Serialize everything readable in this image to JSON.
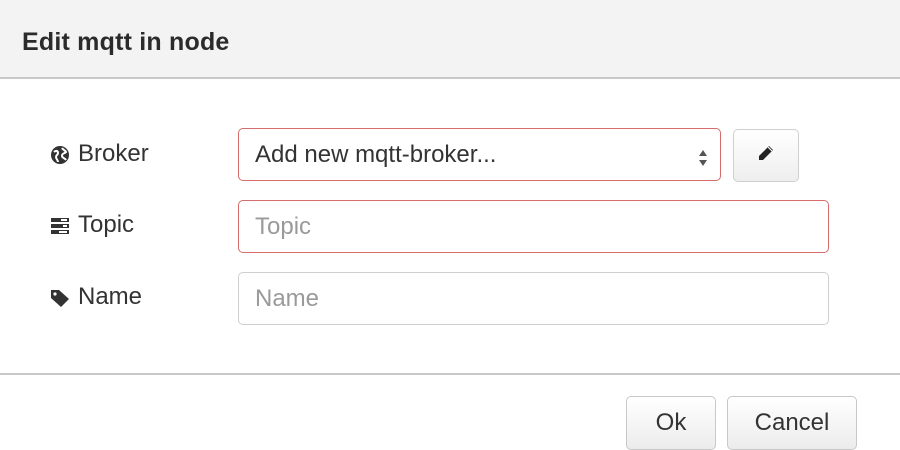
{
  "dialog": {
    "title": "Edit mqtt in node"
  },
  "fields": {
    "broker": {
      "label": "Broker",
      "icon": "globe-icon",
      "selected_value": "Add new mqtt-broker...",
      "edit_icon": "pencil-icon"
    },
    "topic": {
      "label": "Topic",
      "icon": "tasks-icon",
      "value": "",
      "placeholder": "Topic"
    },
    "name": {
      "label": "Name",
      "icon": "tag-icon",
      "value": "",
      "placeholder": "Name"
    }
  },
  "buttons": {
    "ok_label": "Ok",
    "cancel_label": "Cancel"
  },
  "colors": {
    "error_border": "#d56b6b",
    "header_bg": "#f3f3f3"
  }
}
